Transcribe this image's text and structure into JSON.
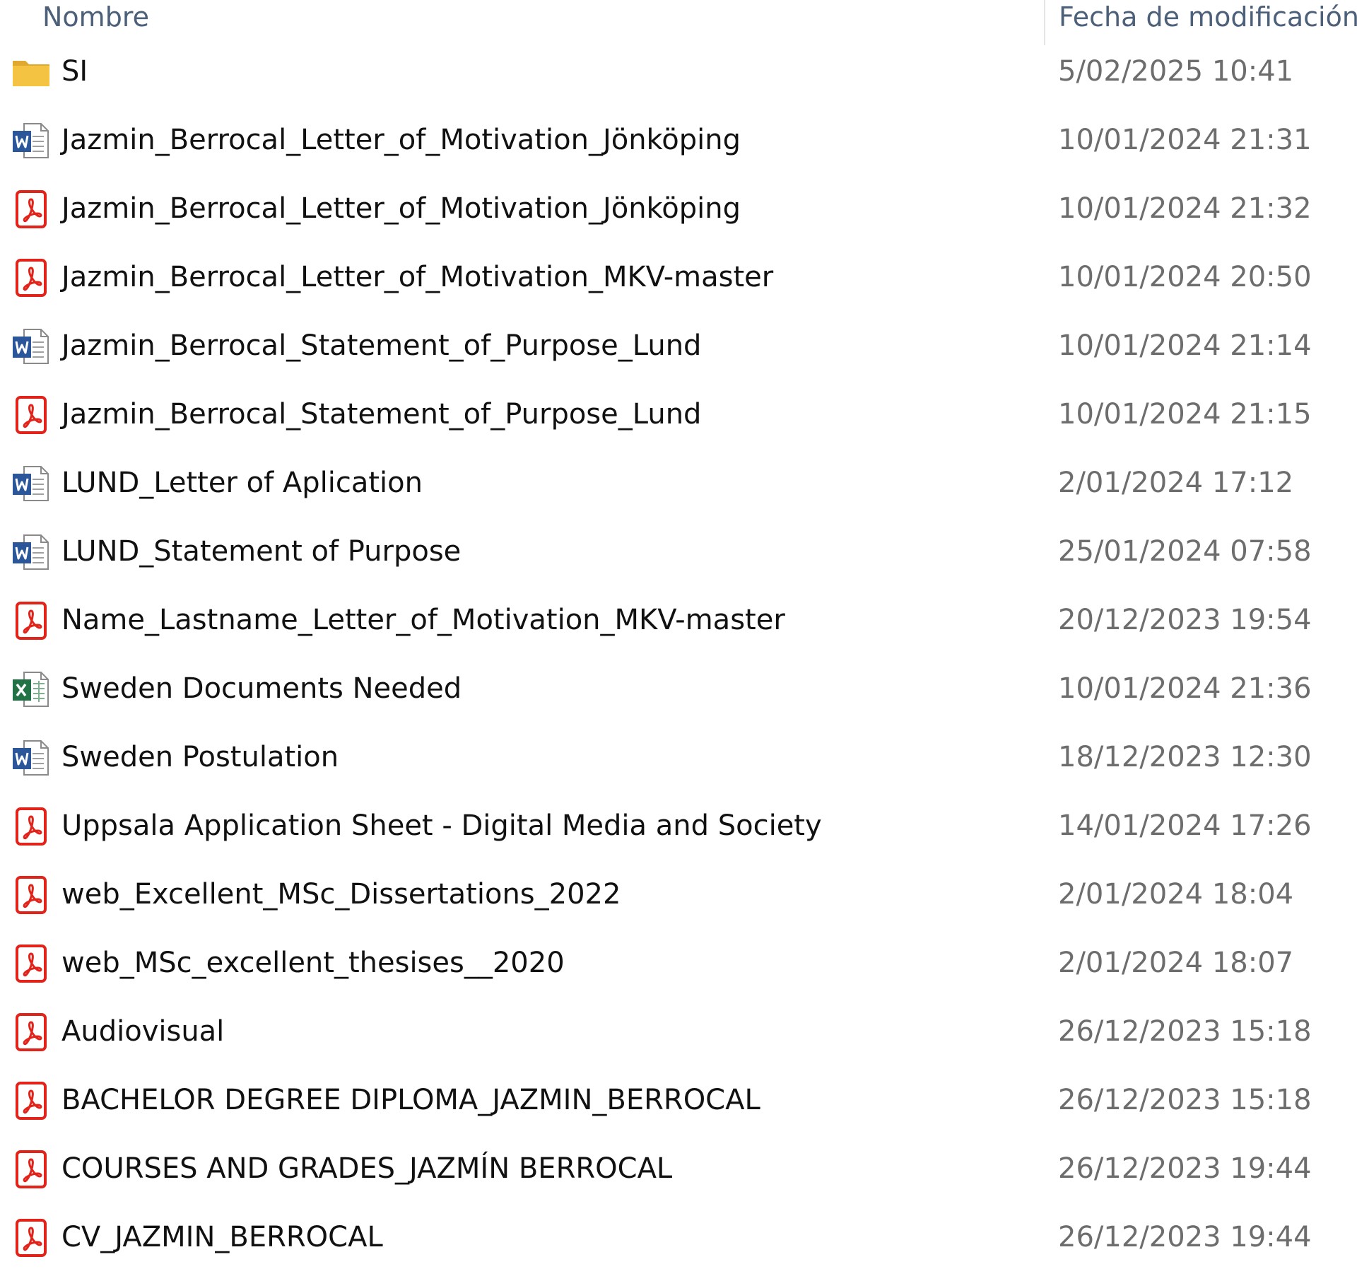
{
  "header": {
    "name_label": "Nombre",
    "date_label": "Fecha de modificación"
  },
  "colors": {
    "folder": "#f5c342",
    "word": "#2b579a",
    "pdf": "#e2231a",
    "excel": "#217346"
  },
  "files": [
    {
      "icon": "folder-icon",
      "name": "SI",
      "date": "5/02/2025 10:41"
    },
    {
      "icon": "word-doc-icon",
      "name": "Jazmin_Berrocal_Letter_of_Motivation_Jönköping",
      "date": "10/01/2024 21:31"
    },
    {
      "icon": "pdf-icon",
      "name": "Jazmin_Berrocal_Letter_of_Motivation_Jönköping",
      "date": "10/01/2024 21:32"
    },
    {
      "icon": "pdf-icon",
      "name": "Jazmin_Berrocal_Letter_of_Motivation_MKV-master",
      "date": "10/01/2024 20:50"
    },
    {
      "icon": "word-doc-icon",
      "name": "Jazmin_Berrocal_Statement_of_Purpose_Lund",
      "date": "10/01/2024 21:14"
    },
    {
      "icon": "pdf-icon",
      "name": "Jazmin_Berrocal_Statement_of_Purpose_Lund",
      "date": "10/01/2024 21:15"
    },
    {
      "icon": "word-doc-icon",
      "name": "LUND_Letter of Aplication",
      "date": "2/01/2024 17:12"
    },
    {
      "icon": "word-doc-icon",
      "name": "LUND_Statement of Purpose",
      "date": "25/01/2024 07:58"
    },
    {
      "icon": "pdf-icon",
      "name": "Name_Lastname_Letter_of_Motivation_MKV-master",
      "date": "20/12/2023 19:54"
    },
    {
      "icon": "excel-sheet-icon",
      "name": "Sweden Documents Needed",
      "date": "10/01/2024 21:36"
    },
    {
      "icon": "word-doc-icon",
      "name": "Sweden Postulation",
      "date": "18/12/2023 12:30"
    },
    {
      "icon": "pdf-icon",
      "name": "Uppsala Application Sheet - Digital Media and Society",
      "date": "14/01/2024 17:26"
    },
    {
      "icon": "pdf-icon",
      "name": "web_Excellent_MSc_Dissertations_2022",
      "date": "2/01/2024 18:04"
    },
    {
      "icon": "pdf-icon",
      "name": "web_MSc_excellent_thesises__2020",
      "date": "2/01/2024 18:07"
    },
    {
      "icon": "pdf-icon",
      "name": "Audiovisual",
      "date": "26/12/2023 15:18"
    },
    {
      "icon": "pdf-icon",
      "name": "BACHELOR DEGREE DIPLOMA_JAZMIN_BERROCAL",
      "date": "26/12/2023 15:18"
    },
    {
      "icon": "pdf-icon",
      "name": "COURSES AND GRADES_JAZMÍN BERROCAL",
      "date": "26/12/2023 19:44"
    },
    {
      "icon": "pdf-icon",
      "name": "CV_JAZMIN_BERROCAL",
      "date": "26/12/2023 19:44"
    }
  ]
}
